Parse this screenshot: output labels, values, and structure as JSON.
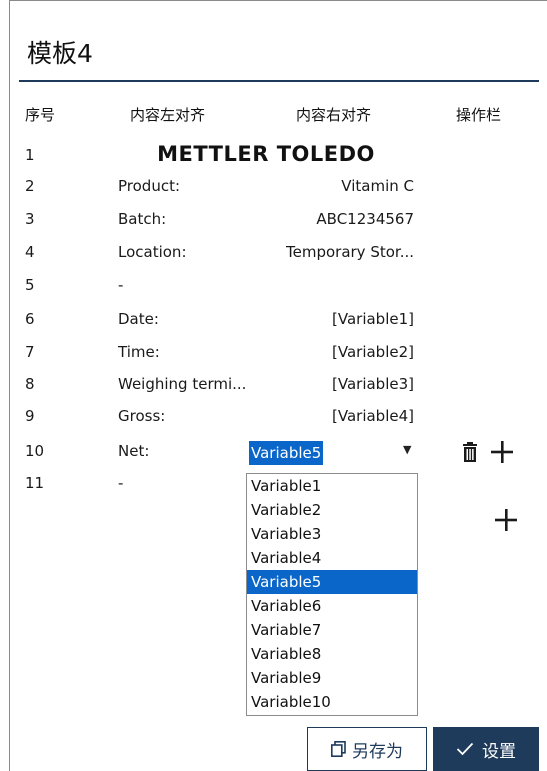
{
  "template_title": "模板4",
  "columns": {
    "seq": "序号",
    "left_align": "内容左对齐",
    "right_align": "内容右对齐",
    "actions": "操作栏"
  },
  "logo_text": "METTLER TOLEDO",
  "rows": [
    {
      "seq": "1",
      "left": "",
      "right": ""
    },
    {
      "seq": "2",
      "left": "Product:",
      "right": "Vitamin C"
    },
    {
      "seq": "3",
      "left": "Batch:",
      "right": "ABC1234567"
    },
    {
      "seq": "4",
      "left": "Location:",
      "right": "Temporary Stor..."
    },
    {
      "seq": "5",
      "left": "-",
      "right": ""
    },
    {
      "seq": "6",
      "left": "Date:",
      "right": "[Variable1]"
    },
    {
      "seq": "7",
      "left": "Time:",
      "right": "[Variable2]"
    },
    {
      "seq": "8",
      "left": "Weighing termi...",
      "right": "[Variable3]"
    },
    {
      "seq": "9",
      "left": "Gross:",
      "right": "[Variable4]"
    },
    {
      "seq": "10",
      "left": "Net:",
      "right": ""
    },
    {
      "seq": "11",
      "left": "-",
      "right": ""
    }
  ],
  "variable_select": {
    "selected": "Variable5",
    "options": [
      "Variable1",
      "Variable2",
      "Variable3",
      "Variable4",
      "Variable5",
      "Variable6",
      "Variable7",
      "Variable8",
      "Variable9",
      "Variable10"
    ]
  },
  "icons": {
    "delete": "trash-icon",
    "add": "plus-icon",
    "caret": "caret-down-icon",
    "saveas": "copy-icon",
    "confirm": "check-icon"
  },
  "buttons": {
    "save_as": "另存为",
    "set": "设置"
  },
  "colors": {
    "primary": "#1f3b5c",
    "selection": "#0a66c8"
  }
}
